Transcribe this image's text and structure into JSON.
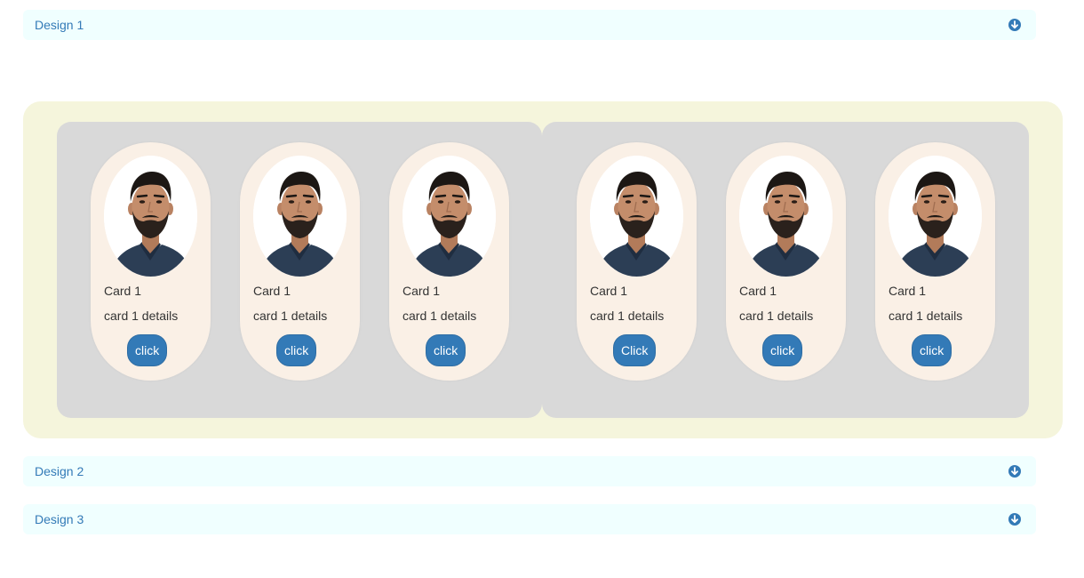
{
  "accordions": [
    {
      "title": "Design 1"
    },
    {
      "title": "Design 2"
    },
    {
      "title": "Design 3"
    }
  ],
  "icon": "circle-arrow-down-icon",
  "colors": {
    "accent": "#337ab7",
    "accordion_bg": "#f0ffff",
    "outer_panel": "#f5f5dc",
    "group_panel": "#d9d9d9",
    "card_bg": "#faf0e6"
  },
  "groups": [
    {
      "cards": [
        {
          "title": "Card 1",
          "text": "card 1 details",
          "button": "click"
        },
        {
          "title": "Card 1",
          "text": "card 1 details",
          "button": "click"
        },
        {
          "title": "Card 1",
          "text": "card 1 details",
          "button": "click"
        }
      ]
    },
    {
      "cards": [
        {
          "title": "Card 1",
          "text": "card 1 details",
          "button": "Click"
        },
        {
          "title": "Card 1",
          "text": "card 1 details",
          "button": "click"
        },
        {
          "title": "Card 1",
          "text": "card 1 details",
          "button": "click"
        }
      ]
    }
  ]
}
